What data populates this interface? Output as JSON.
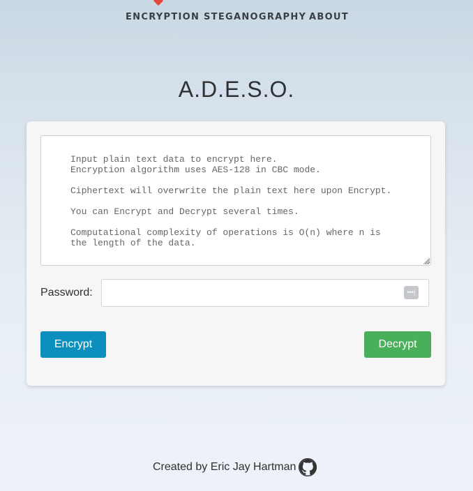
{
  "nav": {
    "items": [
      {
        "label": "ENCRYPTION",
        "active": true
      },
      {
        "label": "STEGANOGRAPHY",
        "active": false
      },
      {
        "label": "ABOUT",
        "active": false
      }
    ],
    "active_marker_color": "#e8453c"
  },
  "page": {
    "title": "A.D.E.S.O."
  },
  "form": {
    "textarea_value": "Input plain text data to encrypt here.\nEncryption algorithm uses AES-128 in CBC mode.\n\nCiphertext will overwrite the plain text here upon Encrypt.\n\nYou can Encrypt and Decrypt several times.\n\nComputational complexity of operations is O(n) where n is\nthe length of the data.",
    "password_label": "Password:",
    "password_value": "",
    "password_icon": "password-manager-icon",
    "encrypt_label": "Encrypt",
    "decrypt_label": "Decrypt",
    "encrypt_color": "#0d8fbe",
    "decrypt_color": "#4aaf5a"
  },
  "footer": {
    "text": "Created by Eric Jay Hartman",
    "icon": "github-icon"
  }
}
